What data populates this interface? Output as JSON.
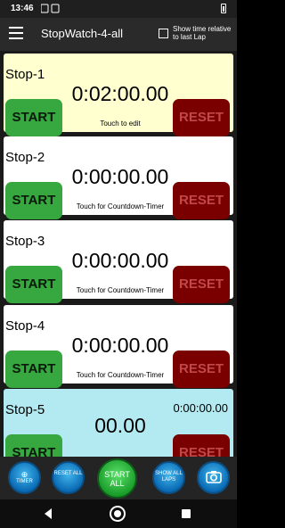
{
  "status": {
    "time": "13:46"
  },
  "appbar": {
    "title": "StopWatch-4-all",
    "checkbox_label": "Show time relative to last Lap"
  },
  "stopwatches": [
    {
      "name": "Stop-1",
      "display": "0:02:00.00",
      "hint": "Touch to edit",
      "start": "START",
      "reset": "RESET",
      "background": "#ffffd0"
    },
    {
      "name": "Stop-2",
      "display": "0:00:00.00",
      "hint": "Touch for Countdown-Timer",
      "start": "START",
      "reset": "RESET",
      "background": "#ffffff"
    },
    {
      "name": "Stop-3",
      "display": "0:00:00.00",
      "hint": "Touch for Countdown-Timer",
      "start": "START",
      "reset": "RESET",
      "background": "#ffffff"
    },
    {
      "name": "Stop-4",
      "display": "0:00:00.00",
      "hint": "Touch for Countdown-Timer",
      "start": "START",
      "reset": "RESET",
      "background": "#ffffff"
    },
    {
      "name": "Stop-5",
      "total": "0:00:00.00",
      "display": "00.00",
      "start": "START",
      "reset": "RESET",
      "background": "#b3eaf1"
    }
  ],
  "bottom": {
    "timer_symbol": "⊕",
    "timer_label": "TIMER",
    "reset_all_label": "RESET ALL",
    "start_all_label": "START ALL",
    "show_laps_label": "SHOW ALL LAPS",
    "camera_icon": "camera-icon"
  },
  "colors": {
    "start_green": "#37a73f",
    "reset_red": "#7a0000",
    "highlight_yellow": "#ffffd0",
    "lap_cyan": "#b3eaf1",
    "round_button_blue": "#0a6bb5"
  }
}
